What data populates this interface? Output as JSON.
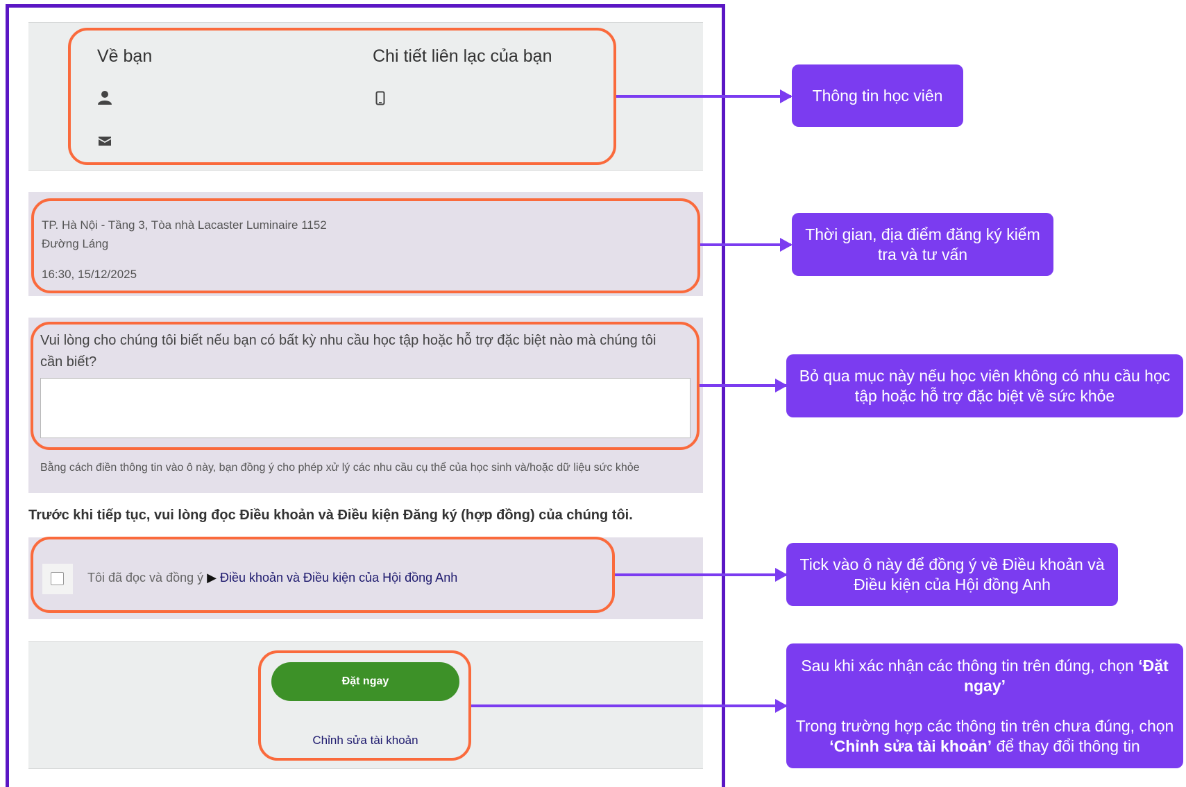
{
  "about": {
    "heading": "Về bạn",
    "contact_heading": "Chi tiết liên lạc của bạn",
    "person_icon": "person-icon",
    "phone_icon": "mobile-phone-icon",
    "email_icon": "envelope-icon"
  },
  "location": {
    "line1": "TP. Hà Nội - Tầng 3, Tòa nhà Lacaster Luminaire 1152",
    "line2": "Đường Láng",
    "datetime": "16:30, 15/12/2025"
  },
  "needs": {
    "question": "Vui lòng cho chúng tôi biết nếu bạn có bất kỳ nhu cầu học tập hoặc hỗ trợ đặc biệt nào mà chúng tôi cần biết?",
    "textarea_value": "",
    "consent_note": "Bằng cách điền thông tin vào ô này, bạn đồng ý cho phép xử lý các nhu cầu cụ thể của học sinh và/hoặc dữ liệu sức khỏe"
  },
  "terms": {
    "intro": "Trước khi tiếp tục, vui lòng đọc Điều khoản và Điều kiện Đăng ký (hợp đồng) của chúng tôi.",
    "agree_prefix": "Tôi đã đọc và đồng ý",
    "triangle": "▶",
    "link": "Điều khoản và Điều kiện của Hội đồng Anh",
    "checked": false
  },
  "actions": {
    "book_label": "Đặt ngay",
    "edit_label": "Chỉnh sửa tài khoản"
  },
  "callouts": {
    "student_info": "Thông tin học viên",
    "time_place": "Thời gian, địa điểm đăng ký kiểm tra và tư vấn",
    "skip": "Bỏ qua mục này nếu học viên không có nhu cầu học tập hoặc hỗ trợ đặc biệt về sức khỏe",
    "tick": "Tick vào ô này để đồng ý về Điều khoản và Điều kiện của Hội đồng Anh",
    "confirm_a": "Sau khi xác nhận các thông tin trên đúng, chọn",
    "confirm_b": "‘Đặt ngay’",
    "confirm_c": "Trong trường hợp các thông tin trên chưa đúng, chọn",
    "confirm_d": "‘Chỉnh sửa tài khoản’",
    "confirm_e": "để thay đổi thông tin"
  },
  "colors": {
    "frame": "#5a16c4",
    "highlight": "#fa6a3c",
    "callout": "#7b3cf0",
    "book_button": "#3d9128"
  }
}
